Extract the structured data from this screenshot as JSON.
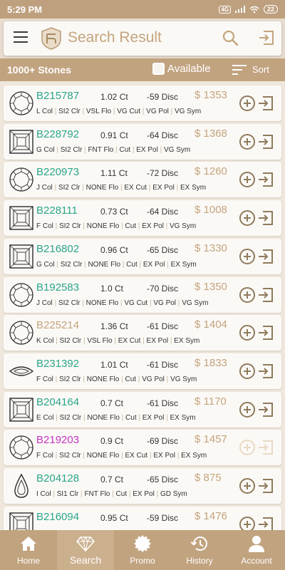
{
  "status_bar": {
    "time": "5:29 PM",
    "battery": "22",
    "network_chip": "4G"
  },
  "header": {
    "title": "Search Result"
  },
  "filter_bar": {
    "count": "1000+ Stones",
    "available_label": "Available",
    "sort_label": "Sort"
  },
  "colors": {
    "gold": "#c3a47d",
    "green": "#2aa58a",
    "magenta": "#c533c5",
    "tan_bar": "#c1a37f"
  },
  "stones": [
    {
      "id": "B215787",
      "shape": "round",
      "id_color": "green",
      "carat": "1.02 Ct",
      "disc": "-59 Disc",
      "price": "$ 1353",
      "color": "L Col",
      "clarity": "SI2 Clr",
      "fluor": "VSL Flo",
      "cut": "VG Cut",
      "polish": "VG Pol",
      "symmetry": "VG Sym",
      "faded": false
    },
    {
      "id": "B228792",
      "shape": "square",
      "id_color": "green",
      "carat": "0.91 Ct",
      "disc": "-64 Disc",
      "price": "$ 1368",
      "color": "G Col",
      "clarity": "SI2 Clr",
      "fluor": "FNT Flo",
      "cut": "Cut",
      "polish": "EX Pol",
      "symmetry": "VG Sym",
      "faded": false
    },
    {
      "id": "B220973",
      "shape": "round",
      "id_color": "green",
      "carat": "1.11 Ct",
      "disc": "-72 Disc",
      "price": "$ 1260",
      "color": "J Col",
      "clarity": "SI2 Clr",
      "fluor": "NONE Flo",
      "cut": "EX Cut",
      "polish": "EX Pol",
      "symmetry": "EX Sym",
      "faded": false
    },
    {
      "id": "B228111",
      "shape": "square",
      "id_color": "green",
      "carat": "0.73 Ct",
      "disc": "-64 Disc",
      "price": "$ 1008",
      "color": "F Col",
      "clarity": "SI2 Clr",
      "fluor": "NONE Flo",
      "cut": "Cut",
      "polish": "EX Pol",
      "symmetry": "VG Sym",
      "faded": false
    },
    {
      "id": "B216802",
      "shape": "square",
      "id_color": "green",
      "carat": "0.96 Ct",
      "disc": "-65 Disc",
      "price": "$ 1330",
      "color": "G Col",
      "clarity": "SI2 Clr",
      "fluor": "NONE Flo",
      "cut": "Cut",
      "polish": "EX Pol",
      "symmetry": "EX Sym",
      "faded": false
    },
    {
      "id": "B192583",
      "shape": "round",
      "id_color": "green",
      "carat": "1.0 Ct",
      "disc": "-70 Disc",
      "price": "$ 1350",
      "color": "J Col",
      "clarity": "SI2 Clr",
      "fluor": "NONE Flo",
      "cut": "VG Cut",
      "polish": "VG Pol",
      "symmetry": "VG Sym",
      "faded": false
    },
    {
      "id": "B225214",
      "shape": "round",
      "id_color": "gold",
      "carat": "1.36 Ct",
      "disc": "-61 Disc",
      "price": "$ 1404",
      "color": "K Col",
      "clarity": "SI2 Clr",
      "fluor": "VSL Flo",
      "cut": "EX Cut",
      "polish": "EX Pol",
      "symmetry": "EX Sym",
      "faded": false
    },
    {
      "id": "B231392",
      "shape": "marquise",
      "id_color": "green",
      "carat": "1.01 Ct",
      "disc": "-61 Disc",
      "price": "$ 1833",
      "color": "F Col",
      "clarity": "SI2 Clr",
      "fluor": "NONE Flo",
      "cut": "Cut",
      "polish": "VG Pol",
      "symmetry": "VG Sym",
      "faded": false
    },
    {
      "id": "B204164",
      "shape": "square",
      "id_color": "green",
      "carat": "0.7 Ct",
      "disc": "-61 Disc",
      "price": "$ 1170",
      "color": "E Col",
      "clarity": "SI2 Clr",
      "fluor": "NONE Flo",
      "cut": "Cut",
      "polish": "EX Pol",
      "symmetry": "EX Sym",
      "faded": false
    },
    {
      "id": "B219203",
      "shape": "round",
      "id_color": "magenta",
      "carat": "0.9 Ct",
      "disc": "-69 Disc",
      "price": "$ 1457",
      "color": "F Col",
      "clarity": "SI2 Clr",
      "fluor": "NONE Flo",
      "cut": "EX Cut",
      "polish": "EX Pol",
      "symmetry": "EX Sym",
      "faded": true
    },
    {
      "id": "B204128",
      "shape": "pear",
      "id_color": "green",
      "carat": "0.7 Ct",
      "disc": "-65 Disc",
      "price": "$ 875",
      "color": "I Col",
      "clarity": "SI1 Clr",
      "fluor": "FNT Flo",
      "cut": "Cut",
      "polish": "EX Pol",
      "symmetry": "GD Sym",
      "faded": false
    },
    {
      "id": "B216094",
      "shape": "square",
      "id_color": "green",
      "carat": "0.95 Ct",
      "disc": "-59 Disc",
      "price": "$ 1476",
      "color": "",
      "clarity": "",
      "fluor": "",
      "cut": "",
      "polish": "",
      "symmetry": "",
      "faded": false
    }
  ],
  "bottom_nav": [
    {
      "label": "Home",
      "icon": "home-icon",
      "active": false
    },
    {
      "label": "Search",
      "icon": "diamond-icon",
      "active": true
    },
    {
      "label": "Promo",
      "icon": "promo-icon",
      "active": false
    },
    {
      "label": "History",
      "icon": "history-icon",
      "active": false
    },
    {
      "label": "Account",
      "icon": "account-icon",
      "active": false
    }
  ]
}
